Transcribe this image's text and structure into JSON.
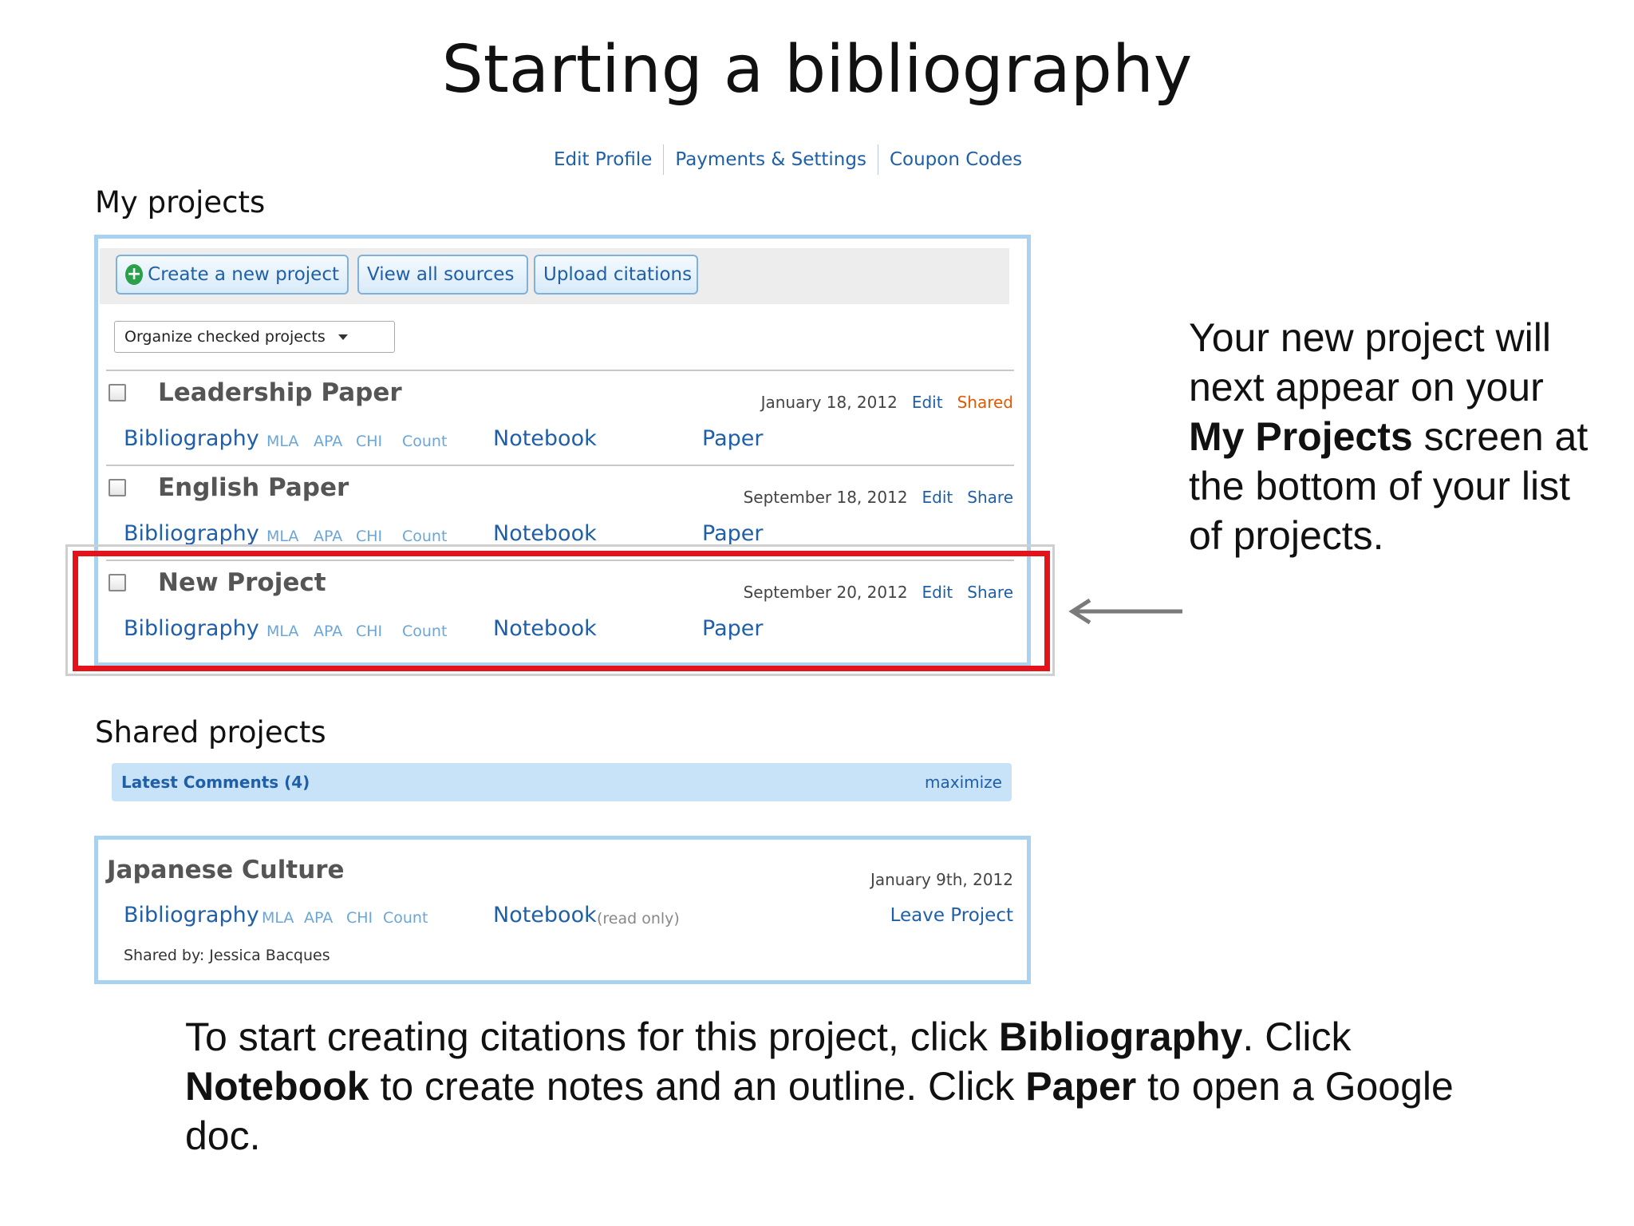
{
  "slide": {
    "title": "Starting a bibliography"
  },
  "account_links": [
    "Edit Profile",
    "Payments & Settings",
    "Coupon Codes"
  ],
  "my_projects": {
    "heading": "My projects",
    "buttons": {
      "create": "Create a new project",
      "view_sources": "View all sources",
      "upload": "Upload citations"
    },
    "organize_select": "Organize checked projects",
    "projects": [
      {
        "name": "Leadership Paper",
        "date": "January 18, 2012",
        "edit": "Edit",
        "share": "Shared",
        "bibliography": "Bibliography",
        "mla": "MLA",
        "apa": "APA",
        "chi": "CHI",
        "count": "Count",
        "notebook": "Notebook",
        "paper": "Paper"
      },
      {
        "name": "English Paper",
        "date": "September 18, 2012",
        "edit": "Edit",
        "share": "Share",
        "bibliography": "Bibliography",
        "mla": "MLA",
        "apa": "APA",
        "chi": "CHI",
        "count": "Count",
        "notebook": "Notebook",
        "paper": "Paper"
      },
      {
        "name": "New Project",
        "date": "September 20, 2012",
        "edit": "Edit",
        "share": "Share",
        "bibliography": "Bibliography",
        "mla": "MLA",
        "apa": "APA",
        "chi": "CHI",
        "count": "Count",
        "notebook": "Notebook",
        "paper": "Paper"
      }
    ]
  },
  "shared_projects": {
    "heading": "Shared projects",
    "comments_label": "Latest Comments (4)",
    "maximize": "maximize",
    "project": {
      "name": "Japanese Culture",
      "date": "January 9th, 2012",
      "bibliography": "Bibliography",
      "mla": "MLA",
      "apa": "APA",
      "chi": "CHI",
      "count": "Count",
      "notebook": "Notebook",
      "read_only": "(read only)",
      "leave": "Leave Project",
      "shared_by": "Shared by: Jessica Bacques"
    }
  },
  "callout": {
    "before": "Your new project will next appear on your",
    "bold": "My Projects",
    "after": "screen at the bottom of your list of projects."
  },
  "instructions": {
    "p1": "To start creating citations for this project, click",
    "b1": "Bibliography",
    "p2": ". Click",
    "b2": "Notebook",
    "p3": "to create notes and an outline. Click",
    "b3": "Paper",
    "p4": "to open a Google doc."
  },
  "colors": {
    "link": "#1f5fa8",
    "panel_border": "#a9d1f0",
    "highlight": "#e3121b",
    "shared": "#e05a00"
  }
}
